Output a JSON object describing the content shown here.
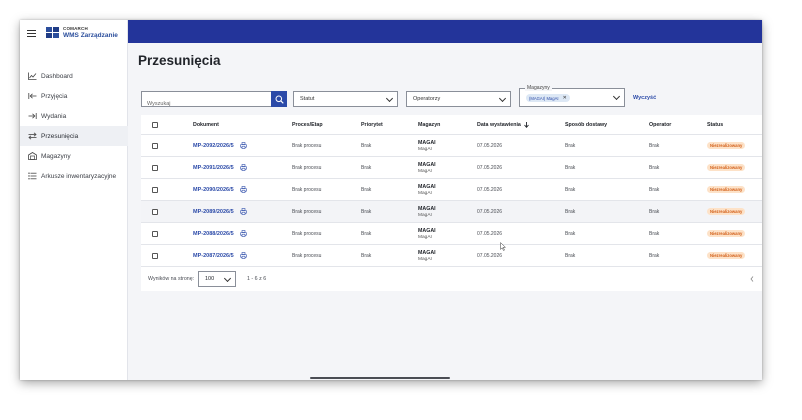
{
  "app": {
    "company": "COMARCH",
    "product": "WMS Zarządzanie"
  },
  "sidebar": {
    "items": [
      {
        "label": "Dashboard",
        "icon": "chart-line-icon"
      },
      {
        "label": "Przyjęcia",
        "icon": "arrow-in-icon"
      },
      {
        "label": "Wydania",
        "icon": "arrow-out-icon"
      },
      {
        "label": "Przesunięcia",
        "icon": "swap-icon",
        "active": true
      },
      {
        "label": "Magazyny",
        "icon": "warehouse-icon"
      },
      {
        "label": "Arkusze inwentaryzacyjne",
        "icon": "list-icon"
      }
    ]
  },
  "page": {
    "title": "Przesunięcia"
  },
  "filters": {
    "search_placeholder": "Wyszukaj",
    "status_label": "Statut",
    "operators_label": "Operatorzy",
    "warehouses_legend": "Magazyny",
    "warehouse_chip": "(MAGAI) MagAI",
    "clear_label": "Wyczyść"
  },
  "table": {
    "columns": {
      "document": "Dokument",
      "process": "Proces/Etap",
      "priority": "Priorytet",
      "warehouse": "Magazyn",
      "issue_date": "Data wystawienia",
      "delivery": "Sposób dostawy",
      "operator": "Operator",
      "status": "Status"
    },
    "rows": [
      {
        "doc": "MP-2092/2026/5",
        "process": "Brak procesu",
        "priority": "Brak",
        "mag_code": "MAGAI",
        "mag_name": "MagAI",
        "date": "07.05.2026",
        "delivery": "Brak",
        "operator": "Brak",
        "status": "Niezrealizowany"
      },
      {
        "doc": "MP-2091/2026/5",
        "process": "Brak procesu",
        "priority": "Brak",
        "mag_code": "MAGAI",
        "mag_name": "MagAI",
        "date": "07.05.2026",
        "delivery": "Brak",
        "operator": "Brak",
        "status": "Niezrealizowany"
      },
      {
        "doc": "MP-2090/2026/5",
        "process": "Brak procesu",
        "priority": "Brak",
        "mag_code": "MAGAI",
        "mag_name": "MagAI",
        "date": "07.05.2026",
        "delivery": "Brak",
        "operator": "Brak",
        "status": "Niezrealizowany"
      },
      {
        "doc": "MP-2089/2026/5",
        "process": "Brak procesu",
        "priority": "Brak",
        "mag_code": "MAGAI",
        "mag_name": "MagAI",
        "date": "07.05.2026",
        "delivery": "Brak",
        "operator": "Brak",
        "status": "Niezrealizowany"
      },
      {
        "doc": "MP-2088/2026/5",
        "process": "Brak procesu",
        "priority": "Brak",
        "mag_code": "MAGAI",
        "mag_name": "MagAI",
        "date": "07.05.2026",
        "delivery": "Brak",
        "operator": "Brak",
        "status": "Niezrealizowany"
      },
      {
        "doc": "MP-2087/2026/5",
        "process": "Brak procesu",
        "priority": "Brak",
        "mag_code": "MAGAI",
        "mag_name": "MagAI",
        "date": "07.05.2026",
        "delivery": "Brak",
        "operator": "Brak",
        "status": "Niezrealizowany"
      }
    ]
  },
  "pagination": {
    "per_page_label": "Wyników na stronę:",
    "per_page_value": "100",
    "range": "1 - 6 z 6"
  },
  "colors": {
    "topbar": "#23349a",
    "accent": "#2b4aa8",
    "status_bg": "#fde2c8",
    "status_text": "#d2601a"
  }
}
